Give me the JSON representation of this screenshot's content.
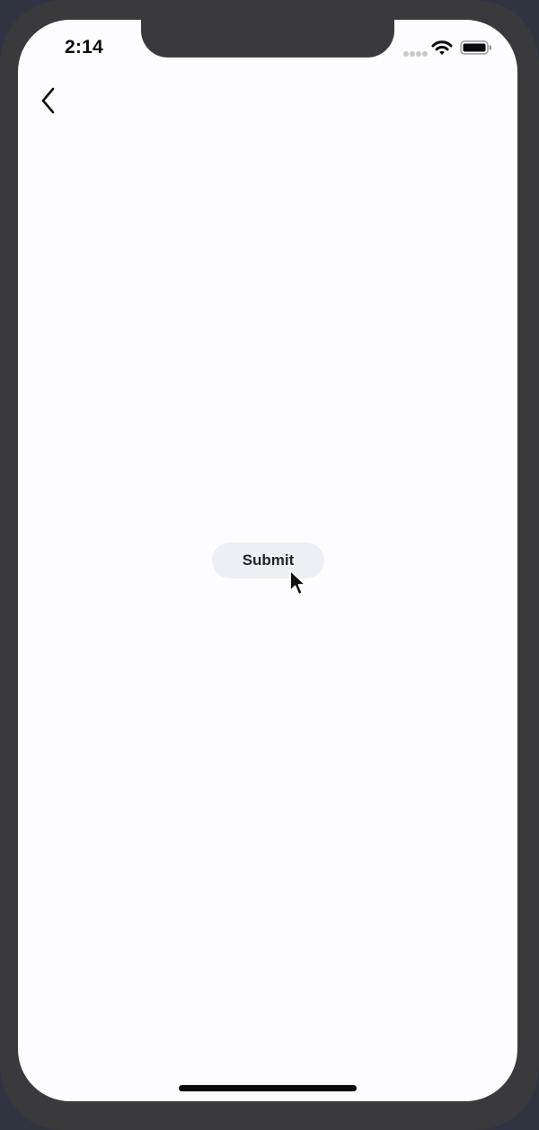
{
  "status_bar": {
    "time": "2:14",
    "icons": [
      "signal-icon",
      "wifi-icon",
      "battery-icon"
    ]
  },
  "nav": {
    "back_icon": "chevron-left-icon"
  },
  "main": {
    "submit_label": "Submit"
  },
  "colors": {
    "device_frame": "#3a393c",
    "screen_background": "#fdfcfe",
    "button_background": "#eceff3",
    "button_text": "#24262a",
    "home_indicator": "#0b0b0d"
  }
}
